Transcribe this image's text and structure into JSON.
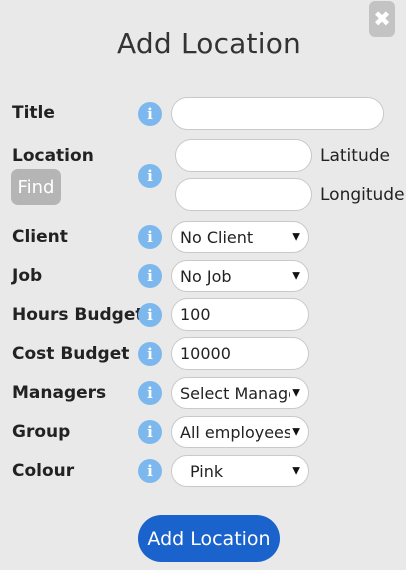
{
  "dialog": {
    "title": "Add Location",
    "close_icon": "close-icon"
  },
  "fields": {
    "title": {
      "label": "Title",
      "value": ""
    },
    "location": {
      "label": "Location",
      "find_label": "Find",
      "latitude_label": "Latitude",
      "longitude_label": "Longitude",
      "latitude_value": "",
      "longitude_value": ""
    },
    "client": {
      "label": "Client",
      "selected": "No Client"
    },
    "job": {
      "label": "Job",
      "selected": "No Job"
    },
    "hours_budget": {
      "label": "Hours Budget",
      "value": "100"
    },
    "cost_budget": {
      "label": "Cost Budget",
      "value": "10000"
    },
    "managers": {
      "label": "Managers",
      "selected": "Select Managers"
    },
    "group": {
      "label": "Group",
      "selected": "All employees"
    },
    "colour": {
      "label": "Colour",
      "selected": "Pink"
    }
  },
  "info_icon": {
    "glyph": "i",
    "color": "#7cb8ee"
  },
  "submit": {
    "label": "Add Location",
    "color": "#1a62cc"
  }
}
